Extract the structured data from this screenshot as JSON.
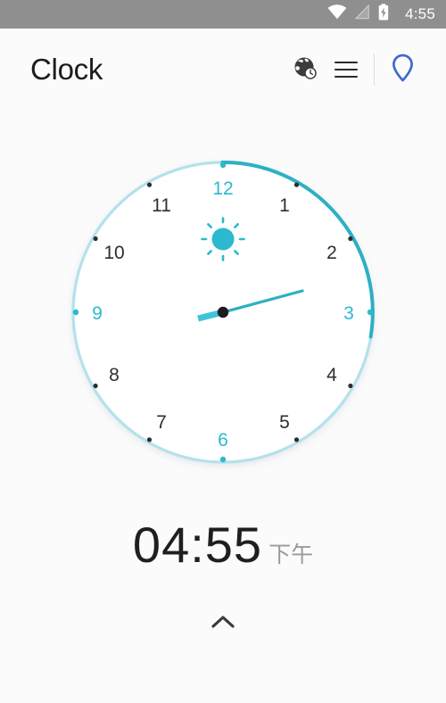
{
  "status_bar": {
    "time": "4:55",
    "background_color": "#8f8f8f",
    "icons": [
      {
        "name": "wifi-icon",
        "label": "wifi"
      },
      {
        "name": "cellular-signal-icon",
        "label": "no-signal"
      },
      {
        "name": "battery-charging-icon",
        "label": "battery-charging"
      }
    ]
  },
  "app_bar": {
    "title": "Clock",
    "actions": [
      {
        "name": "world-clock-icon",
        "label": "world-clock"
      },
      {
        "name": "menu-icon",
        "label": "menu"
      },
      {
        "name": "location-pin-icon",
        "label": "location",
        "color": "#3f68cf"
      }
    ]
  },
  "clock": {
    "type": "analog",
    "numerals": [
      {
        "value": "12",
        "accent": true
      },
      {
        "value": "1",
        "accent": false
      },
      {
        "value": "2",
        "accent": false
      },
      {
        "value": "3",
        "accent": true
      },
      {
        "value": "4",
        "accent": false
      },
      {
        "value": "5",
        "accent": false
      },
      {
        "value": "6",
        "accent": true
      },
      {
        "value": "7",
        "accent": false
      },
      {
        "value": "8",
        "accent": false
      },
      {
        "value": "9",
        "accent": true
      },
      {
        "value": "10",
        "accent": false
      },
      {
        "value": "11",
        "accent": false
      }
    ],
    "day_indicator": "sun-icon",
    "accent_color": "#2cb9cf",
    "ring_light_color": "#b3e2ea",
    "numeral_dark_color": "#2e2e30",
    "hand_long_angle_deg": 105,
    "hand_short_angle_deg": 258,
    "progress_arc_start_deg": 0,
    "progress_arc_end_deg": 88
  },
  "time_display": {
    "time": "04:55",
    "period": "下午"
  },
  "expand": {
    "icon": "chevron-up-icon"
  }
}
